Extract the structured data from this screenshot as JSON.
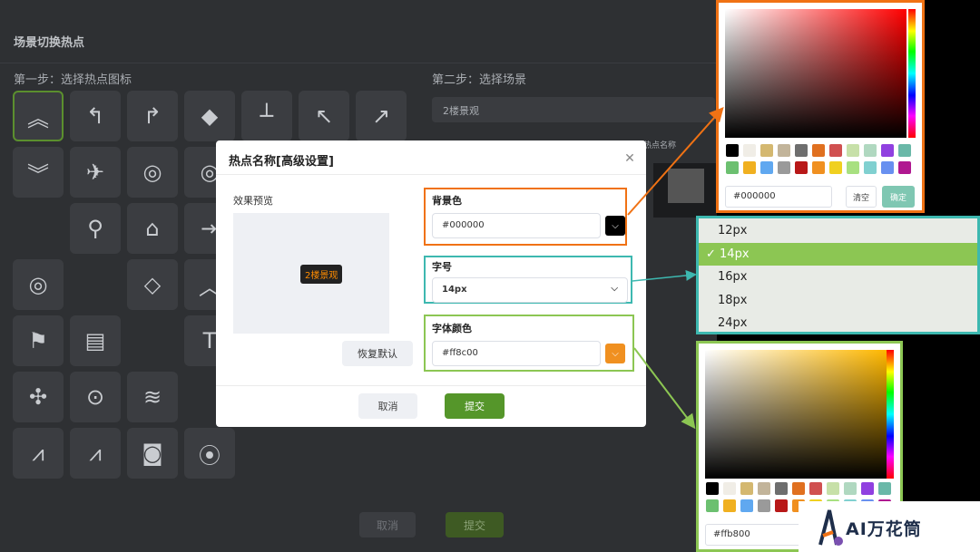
{
  "background": {
    "title": "场景切换热点",
    "step1": "第一步：选择热点图标",
    "step2": "第二步：选择场景",
    "scene_select": "2楼景观",
    "thumb_label": "选热点名称",
    "cancel": "取消",
    "submit": "提交",
    "icons": [
      "chevron-up-double-icon",
      "turn-left-icon",
      "turn-right-icon",
      "cube-icon",
      "pole-icon",
      "arrow-up-left-icon",
      "arrow-up-right-icon",
      "chevron-down-icon",
      "helicopter-icon",
      "ripple-icon",
      "ripple-icon",
      "",
      "location-pin-icon",
      "tag-icon",
      "exit-door-icon",
      "ripple-icon",
      "",
      "warning-diamond-icon",
      "chevron-up-icon",
      "flag-icon",
      "film-icon",
      "",
      "text-t-icon",
      "drone-icon",
      "map-marker-icon",
      "waves-icon",
      "",
      "road-icon",
      "road-icon",
      "camera-icon",
      "signal-icon",
      "",
      "dot-icon",
      "helicopter-icon",
      "sparkle-icon",
      "turn-back-icon"
    ]
  },
  "dialog": {
    "title": "热点名称[高级设置]",
    "preview_label": "效果预览",
    "preview_tag": "2楼景观",
    "reset": "恢复默认",
    "bg_color_label": "背景色",
    "bg_color_value": "#000000",
    "font_size_label": "字号",
    "font_size_value": "14px",
    "font_color_label": "字体颜色",
    "font_color_value": "#ff8c00",
    "cancel": "取消",
    "submit": "提交"
  },
  "bg_picker": {
    "hex": "#000000",
    "clear": "清空",
    "confirm": "确定",
    "base_hue": "#ff0000",
    "palette": [
      "#000000",
      "#f0ede6",
      "#d4b870",
      "#c2b49a",
      "#6e6e6e",
      "#e07020",
      "#d05050",
      "#c7e0a8",
      "#b0d8c0",
      "#9040e0",
      "#6ab8a8",
      "#6cc070",
      "#f0b020",
      "#60a8f0",
      "#9a9a9a",
      "#b81818",
      "#f09020",
      "#f0d020",
      "#a8e080",
      "#80d0d0",
      "#6890f0",
      "#b01890"
    ]
  },
  "font_sizes": {
    "items": [
      "12px",
      "14px",
      "16px",
      "18px",
      "24px"
    ],
    "selected": "14px",
    "check": "✓"
  },
  "fc_picker": {
    "hex": "#ffb800",
    "base_hue": "#ffb800",
    "palette": [
      "#000000",
      "#f0ede6",
      "#d4b870",
      "#c2b49a",
      "#6e6e6e",
      "#e07020",
      "#d05050",
      "#c7e0a8",
      "#b0d8c0",
      "#9040e0",
      "#6ab8a8",
      "#6cc070",
      "#f0b020",
      "#60a8f0",
      "#9a9a9a",
      "#b81818",
      "#f09020",
      "#f0d020",
      "#a8e080",
      "#80d0d0",
      "#6890f0",
      "#b01890"
    ]
  },
  "logo": {
    "text": "AI万花筒"
  },
  "colors": {
    "orange": "#f07214",
    "teal": "#3db8b0",
    "green": "#8cc653",
    "submit": "#55962a"
  }
}
